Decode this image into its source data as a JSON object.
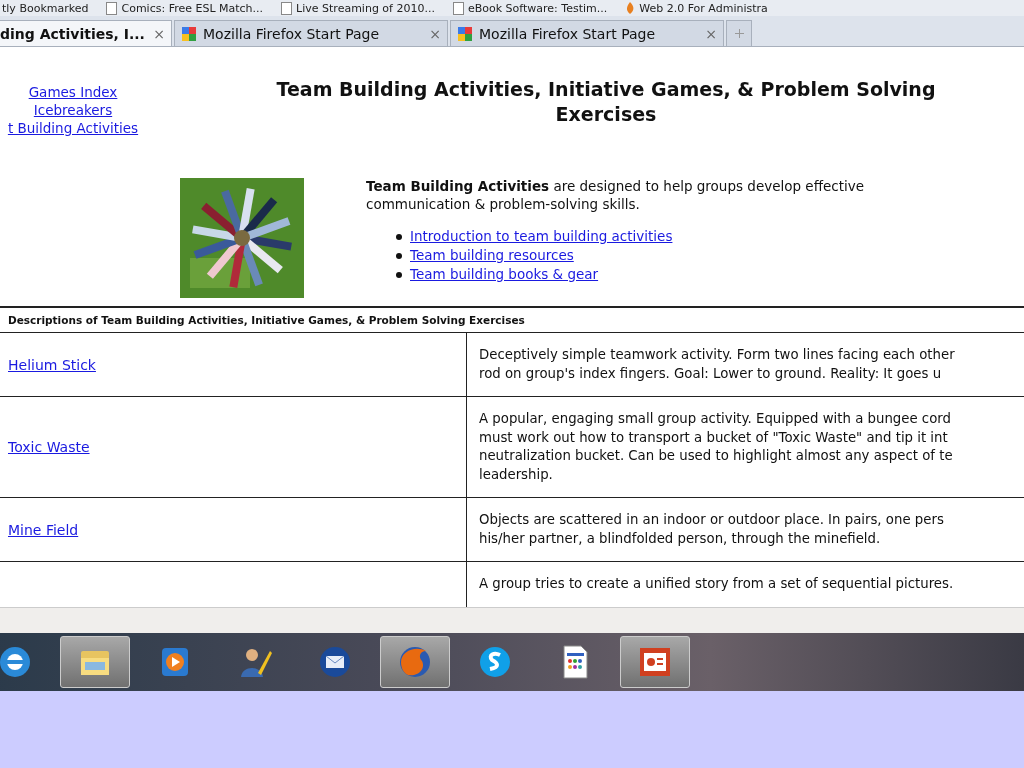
{
  "bookmarks": [
    {
      "label": "tly Bookmarked",
      "kind": "plain"
    },
    {
      "label": "Comics: Free ESL Match...",
      "kind": "page"
    },
    {
      "label": "Live Streaming of 2010...",
      "kind": "page"
    },
    {
      "label": "eBook Software: Testim...",
      "kind": "page"
    },
    {
      "label": "Web 2.0 For Administra",
      "kind": "flame"
    }
  ],
  "tabs": [
    {
      "label": "ding Activities, I...",
      "close": "×",
      "selected": true
    },
    {
      "label": "Mozilla Firefox Start Page",
      "close": "×",
      "selected": false
    },
    {
      "label": "Mozilla Firefox Start Page",
      "close": "×",
      "selected": false
    }
  ],
  "nav_links": [
    "Games Index",
    "Icebreakers",
    "t Building Activities"
  ],
  "title": "Team Building Activities, Initiative Games, & Problem Solving Exercises",
  "intro": {
    "text": "**Team Building Activities** are designed to help groups develop effective communication & problem-solving skills.",
    "links": [
      "Introduction to team building activities",
      "Team building resources",
      "Team building books & gear"
    ]
  },
  "table": {
    "heading": "Descriptions of Team Building Activities, Initiative Games, & Problem Solving Exercises",
    "rows": [
      {
        "name": "Helium Stick",
        "lines": [
          "Deceptively simple teamwork activity.  Form two lines facing each other",
          "rod on group's index fingers.  Goal: Lower to ground.  Reality: It goes u"
        ]
      },
      {
        "name": "Toxic Waste",
        "lines": [
          "A popular, engaging small group activity.  Equipped with a bungee cord",
          "must work out how to transport a bucket of \"Toxic Waste\" and tip it int",
          "neutralization bucket.  Can be used to highlight almost any aspect of te",
          "leadership."
        ]
      },
      {
        "name": "Mine Field",
        "lines": [
          "Objects are scattered in an indoor or outdoor place.  In pairs, one pers",
          "his/her partner, a blindfolded person, through the minefield."
        ]
      },
      {
        "name": "",
        "lines": [
          "A group tries to create a unified story from a set of sequential pictures."
        ]
      }
    ]
  },
  "taskbar": [
    {
      "kind": "globe",
      "highlighted": false
    },
    {
      "kind": "folder",
      "highlighted": true
    },
    {
      "kind": "play",
      "highlighted": false
    },
    {
      "kind": "person",
      "highlighted": false
    },
    {
      "kind": "mail",
      "highlighted": false
    },
    {
      "kind": "browser",
      "highlighted": true
    },
    {
      "kind": "chat",
      "highlighted": false
    },
    {
      "kind": "document",
      "highlighted": false
    },
    {
      "kind": "slides",
      "highlighted": true
    }
  ]
}
